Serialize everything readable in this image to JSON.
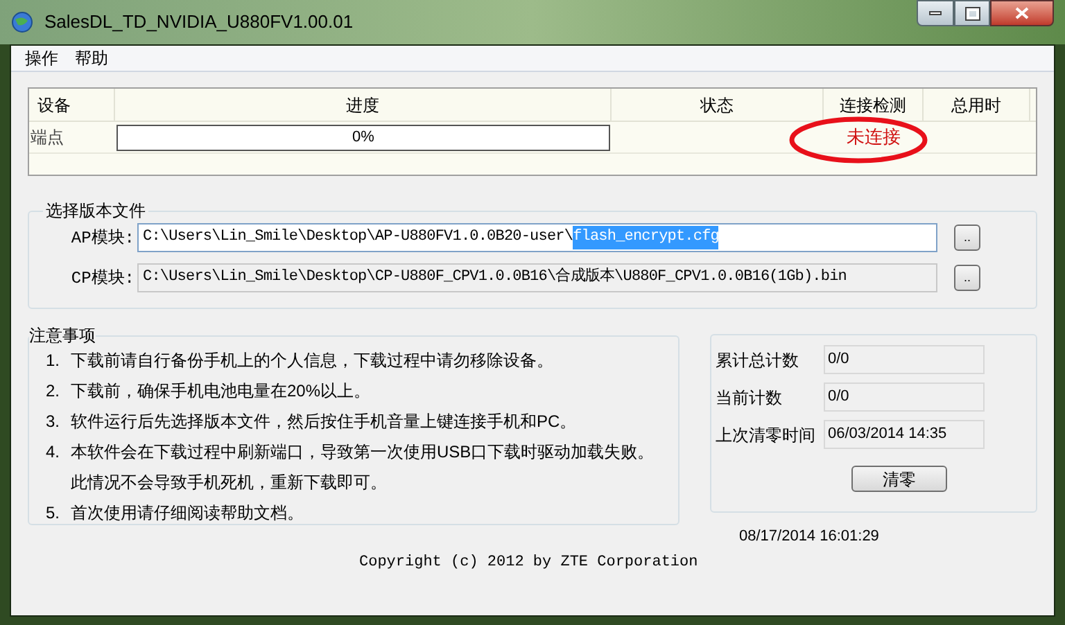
{
  "window": {
    "title": "SalesDL_TD_NVIDIA_U880FV1.00.01"
  },
  "menu": [
    {
      "label": "操作"
    },
    {
      "label": "帮助"
    }
  ],
  "device_table": {
    "columns": [
      "设备",
      "进度",
      "状态",
      "连接检测",
      "总用时"
    ],
    "rows": [
      {
        "device": "端点",
        "level": 0,
        "progress_text": "0%",
        "connection": "未连接"
      }
    ]
  },
  "annotation": {
    "kind": "ellipse",
    "color": "#e8101a"
  },
  "version_files": {
    "title": "选择版本文件",
    "fields": [
      {
        "label": "AP模块:",
        "value": "C:\\Users\\Lin_Smile\\Desktop\\AP-U880FV1.0.0B20-user\\",
        "selection": "flash_encrypt.cfg",
        "browse": ".."
      },
      {
        "label": "CP模块:",
        "value": "C:\\Users\\Lin_Smile\\Desktop\\CP-U880F_CPV1.0.0B16\\合成版本\\U880F_CPV1.0.0B16(1Gb).bin",
        "browse": ".."
      }
    ]
  },
  "notes": {
    "title": "注意事项",
    "items": [
      {
        "number": "1.",
        "lines": [
          "下载前请自行备份手机上的个人信息，下载过程中请勿移除设备。"
        ]
      },
      {
        "number": "2.",
        "lines": [
          "下载前，确保手机电池电量在20%以上。"
        ]
      },
      {
        "number": "3.",
        "lines": [
          "软件运行后先选择版本文件，然后按住手机音量上键连接手机和PC。"
        ]
      },
      {
        "number": "4.",
        "lines": [
          "本软件会在下载过程中刷新端口，导致第一次使用USB口下载时驱动加载失败。",
          "此情况不会导致手机死机，重新下载即可。"
        ]
      },
      {
        "number": "5.",
        "lines": [
          "首次使用请仔细阅读帮助文档。"
        ]
      }
    ]
  },
  "stats": {
    "fields": [
      {
        "label": "累计总计数",
        "value": "0/0"
      },
      {
        "label": "当前计数",
        "value": "0/0"
      },
      {
        "label": "上次清零时间",
        "value": "06/03/2014 14:35"
      }
    ],
    "reset_button": "清零"
  },
  "clock": "08/17/2014 16:01:29",
  "copyright": "Copyright (c) 2012 by ZTE Corporation"
}
